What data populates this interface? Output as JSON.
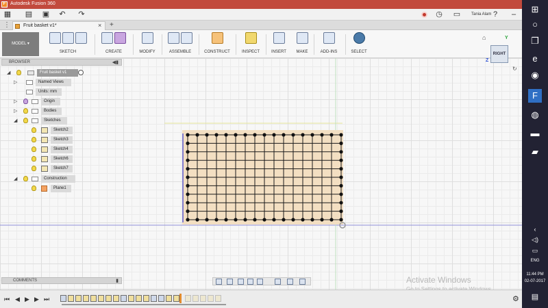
{
  "window": {
    "title": "Autodesk Fusion 360",
    "user": "Tania Alam"
  },
  "tab": {
    "document": "Fruit basket v1*"
  },
  "ribbon": {
    "workspace": "MODEL",
    "groups": [
      "SKETCH",
      "CREATE",
      "MODIFY",
      "ASSEMBLE",
      "CONSTRUCT",
      "INSPECT",
      "INSERT",
      "MAKE",
      "ADD-INS",
      "SELECT"
    ]
  },
  "browser": {
    "title": "BROWSER",
    "root": "Fruit basket v1",
    "named_views": "Named Views",
    "units": "Units: mm",
    "origin": "Origin",
    "bodies": "Bodies",
    "sketches": "Sketches",
    "sketch_items": [
      "Sketch2",
      "Sketch3",
      "Sketch4",
      "Sketch6",
      "Sketch7"
    ],
    "construction": "Construction",
    "plane": "Plane1"
  },
  "viewcube": {
    "face": "RIGHT",
    "axis_z": "Z",
    "axis_y": "Y"
  },
  "comments": {
    "title": "COMMENTS"
  },
  "watermark": {
    "line1": "Activate Windows",
    "line2": "Go to Settings to activate Windows."
  },
  "system": {
    "language": "ENG",
    "time": "11:44 PM",
    "date": "02-07-2017"
  },
  "sketch_grid": {
    "columns": 16,
    "rows": 10
  },
  "colors": {
    "titlebar": "#c24a3d",
    "sketch_fill": "#f3dfc2",
    "construction_line": "#e4e49a",
    "axis_line": "#8f8fd8"
  }
}
